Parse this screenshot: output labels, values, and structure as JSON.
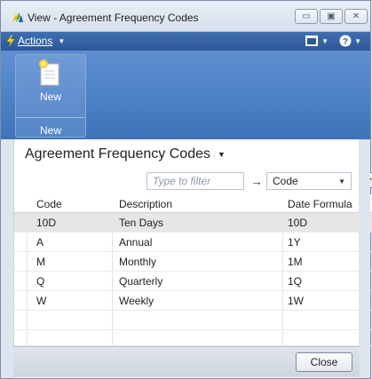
{
  "window": {
    "title": "View - Agreement Frequency Codes"
  },
  "actions_bar": {
    "actions_label": "Actions"
  },
  "ribbon": {
    "new_button_label": "New",
    "group_label": "New"
  },
  "page": {
    "title": "Agreement Frequency Codes",
    "filter_placeholder": "Type to filter",
    "filter_field": "Code"
  },
  "grid": {
    "headers": {
      "code": "Code",
      "description": "Description",
      "date_formula": "Date Formula"
    },
    "rows": [
      {
        "code": "10D",
        "description": "Ten Days",
        "date_formula": "10D"
      },
      {
        "code": "A",
        "description": "Annual",
        "date_formula": "1Y"
      },
      {
        "code": "M",
        "description": "Monthly",
        "date_formula": "1M"
      },
      {
        "code": "Q",
        "description": "Quarterly",
        "date_formula": "1Q"
      },
      {
        "code": "W",
        "description": "Weekly",
        "date_formula": "1W"
      }
    ]
  },
  "footer": {
    "close_label": "Close"
  },
  "colors": {
    "ribbon": "#4a7fc4",
    "actions_bar": "#2c5797",
    "selected_row": "#e6e6e6"
  }
}
